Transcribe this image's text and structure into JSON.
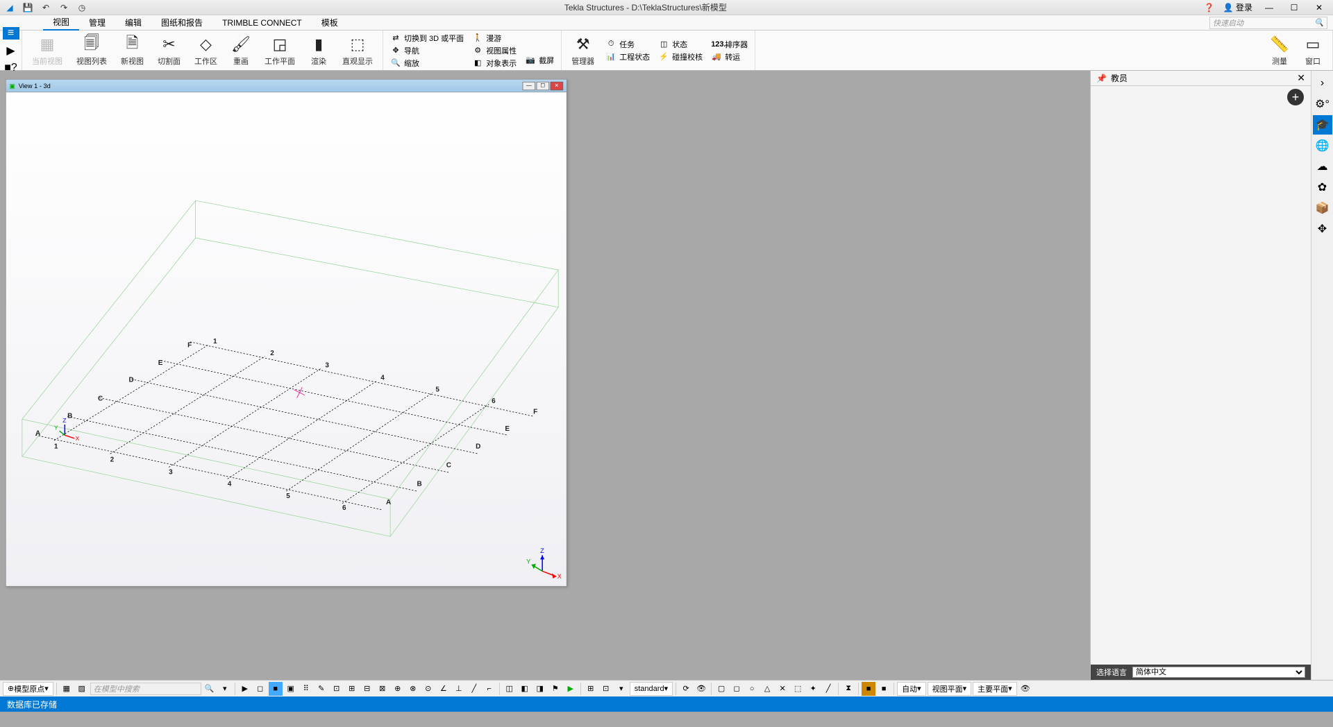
{
  "title": "Tekla Structures - D:\\TeklaStructures\\新模型",
  "title_right": {
    "login": "登录"
  },
  "menu": {
    "items": [
      "视图",
      "管理",
      "编辑",
      "图纸和报告",
      "TRIMBLE CONNECT",
      "模板"
    ],
    "search_placeholder": "快速启动"
  },
  "ribbon": {
    "btns": {
      "current_view": "当前视图",
      "view_list": "视图列表",
      "new_view": "新视图",
      "clip_plane": "切割面",
      "work_area": "工作区",
      "redraw": "重画",
      "work_plane": "工作平面",
      "render": "渲染",
      "direct_display": "直观显示",
      "manager": "管理器",
      "measure": "测量",
      "window": "窗口"
    },
    "small": {
      "switch_3d": "切换到 3D 或平面",
      "navigate": "导航",
      "zoom": "缩放",
      "roam": "漫游",
      "view_props": "视图属性",
      "obj_rep": "对象表示",
      "screenshot": "截屏",
      "task": "任务",
      "proj_status": "工程状态",
      "status": "状态",
      "clash_check": "碰撞校核",
      "sorter": "排序器",
      "sorter_prefix": "123...",
      "transport": "转运"
    }
  },
  "subwindow": {
    "title": "View 1 - 3d"
  },
  "grid": {
    "letters": [
      "A",
      "B",
      "C",
      "D",
      "E",
      "F"
    ],
    "numbers": [
      "1",
      "2",
      "3",
      "4",
      "5",
      "6"
    ],
    "axes": {
      "x": "X",
      "y": "Y",
      "z": "Z"
    }
  },
  "side": {
    "title": "教员",
    "lang_label": "选择语言",
    "lang_value": "简体中文"
  },
  "bottom": {
    "snap_mode": "模型原点",
    "search_placeholder": "在模型中搜索",
    "standard": "standard",
    "auto": "自动",
    "view_plane": "视图平面",
    "main_plane": "主要平面"
  },
  "status": "数据库已存储"
}
